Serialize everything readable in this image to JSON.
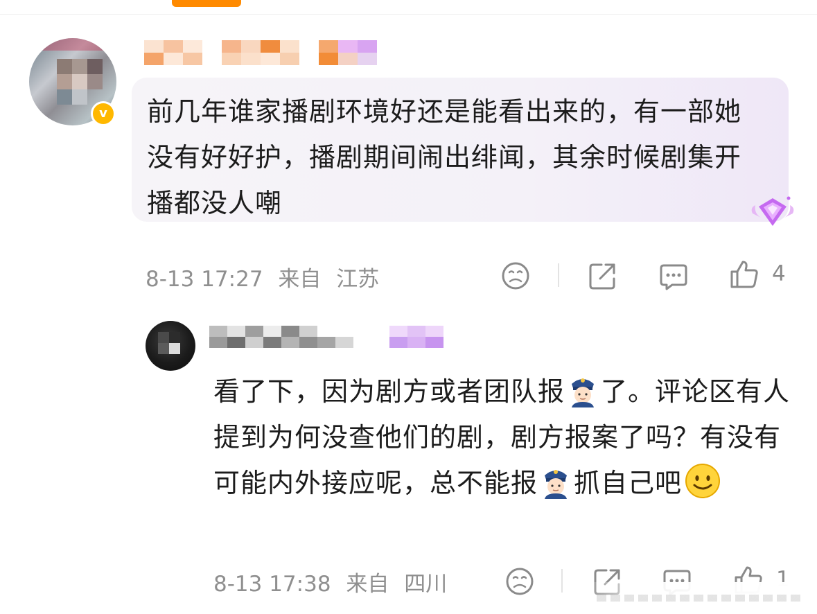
{
  "comment_1": {
    "text": "前几年谁家播剧环境好还是能看出来的，有一部她没有好好护，播剧期间闹出绯闻，其余时候剧集开播都没人嘲",
    "date": "8-13 17:27",
    "source_prefix": "来自",
    "location": "江苏",
    "likes": "4"
  },
  "comment_2": {
    "text_part1": "看了下，因为剧方或者团队报",
    "text_part2": "了。评论区有人提到为何没查他们的剧，剧方报案了吗？有没有可能内外接应呢，总不能报",
    "text_part3": "抓自己吧",
    "date": "8-13 17:38",
    "source_prefix": "来自",
    "location": "四川",
    "likes": "1"
  },
  "icons": [
    "sad-face-icon",
    "share-icon",
    "comment-icon",
    "thumbs-up-icon",
    "police-officer-emoji",
    "smile-emoji",
    "gem-badge-icon",
    "verified-badge-icon"
  ],
  "colors": {
    "accent": "#ff8a00",
    "verified": "#ffb800",
    "meta_text": "#8f8f8f",
    "bubble": "#f4f1f8"
  }
}
